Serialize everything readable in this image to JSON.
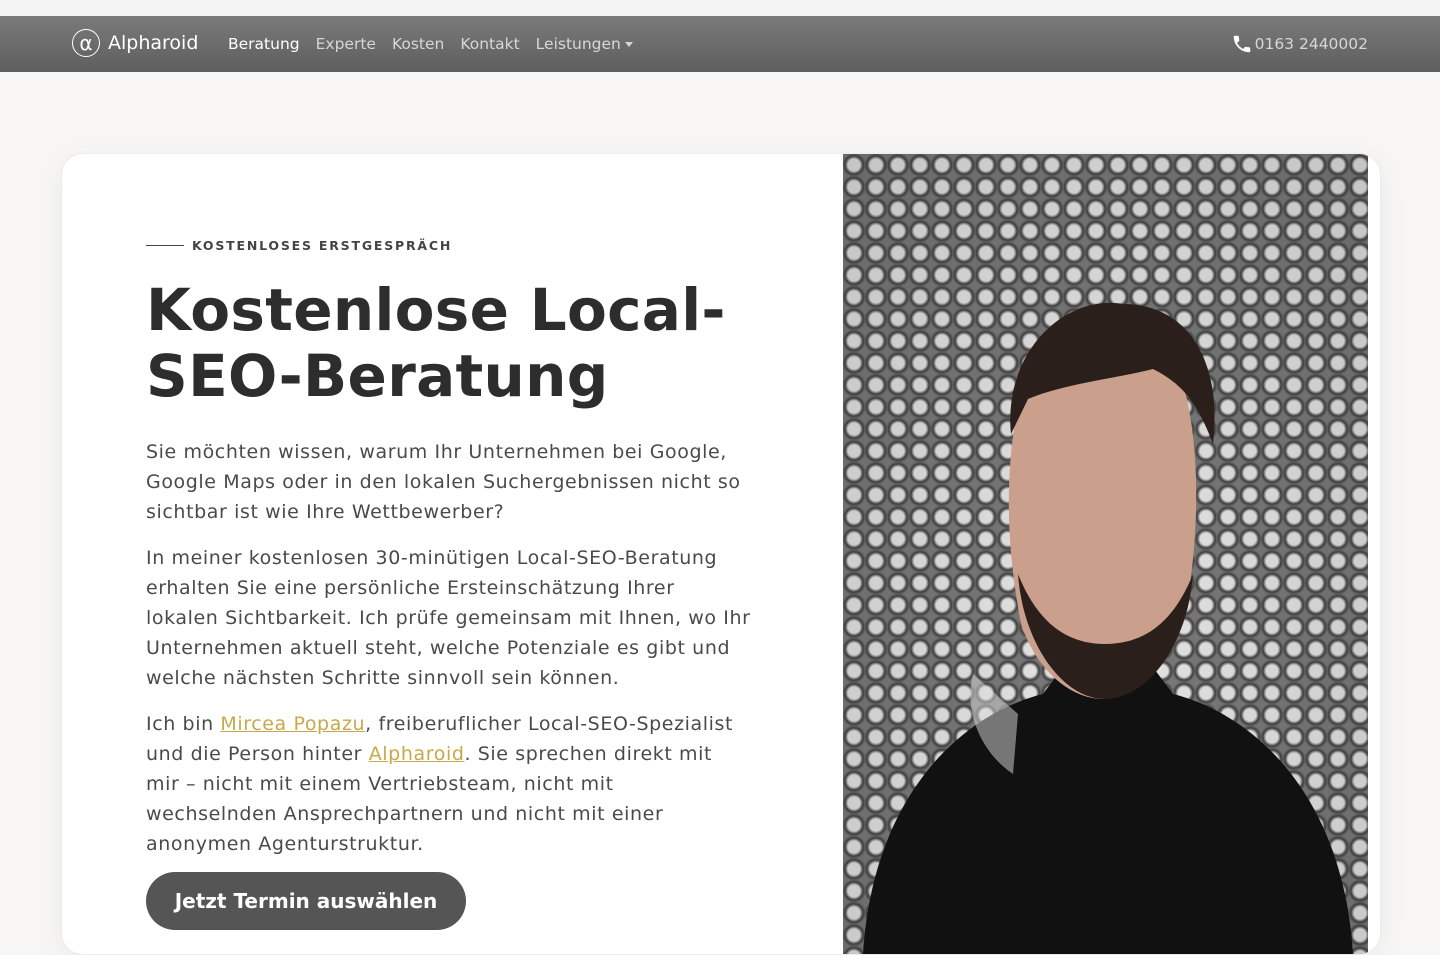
{
  "navbar": {
    "brand": "Alpharoid",
    "brand_symbol": "α",
    "items": [
      {
        "label": "Beratung",
        "active": true
      },
      {
        "label": "Experte"
      },
      {
        "label": "Kosten"
      },
      {
        "label": "Kontakt"
      },
      {
        "label": "Leistungen",
        "dropdown": true
      }
    ],
    "phone": "0163 2440002"
  },
  "hero": {
    "eyebrow": "KOSTENLOSES ERSTGESPRÄCH",
    "title": "Kostenlose Local-SEO-Beratung",
    "p1": "Sie möchten wissen, warum Ihr Unternehmen bei Google, Google Maps oder in den lokalen Suchergebnissen nicht so sichtbar ist wie Ihre Wettbewerber?",
    "p2": "In meiner kostenlosen 30-minütigen Local-SEO-Beratung erhalten Sie eine persönliche Ersteinschätzung Ihrer lokalen Sichtbarkeit. Ich prüfe gemeinsam mit Ihnen, wo Ihr Unternehmen aktuell steht, welche Potenziale es gibt und welche nächsten Schritte sinnvoll sein können.",
    "p3_pre": "Ich bin ",
    "p3_link1": "Mircea Popazu",
    "p3_mid": ", freiberuflicher Local-SEO-Spezialist und die Person hinter ",
    "p3_link2": "Alpharoid",
    "p3_post": ". Sie sprechen direkt mit mir – nicht mit einem Vertriebsteam, nicht mit wechselnden Ansprechpartnern und nicht mit einer anonymen Agenturstruktur.",
    "cta": "Jetzt Termin auswählen"
  },
  "colors": {
    "accent_link": "#c9a84a",
    "navbar": "#6b6b6b",
    "cta": "#555555"
  }
}
